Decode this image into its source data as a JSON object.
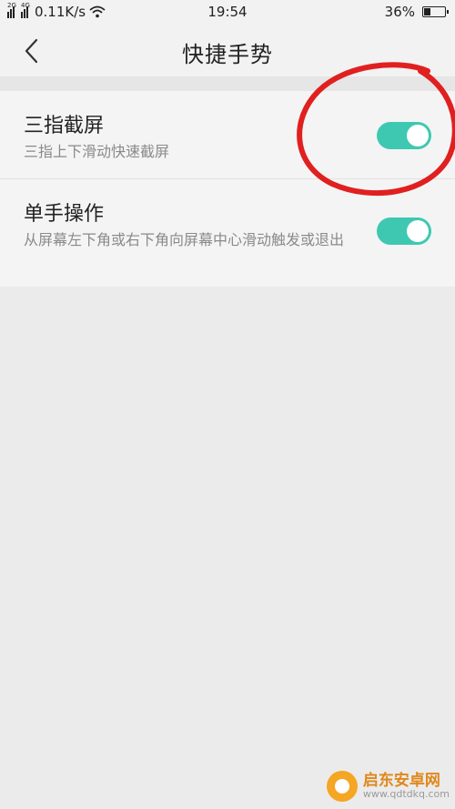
{
  "status_bar": {
    "net_tag_1": "2G",
    "net_tag_2": "4G",
    "speed": "0.11K/s",
    "time": "19:54",
    "battery_percent": "36%",
    "battery_level": 0.36
  },
  "header": {
    "back_icon": "chevron-left-icon",
    "title": "快捷手势"
  },
  "settings": [
    {
      "title": "三指截屏",
      "subtitle": "三指上下滑动快速截屏",
      "enabled": true
    },
    {
      "title": "单手操作",
      "subtitle": "从屏幕左下角或右下角向屏幕中心滑动触发或退出",
      "enabled": true
    }
  ],
  "colors": {
    "toggle_on": "#3ec8b2",
    "annotation": "#e02020"
  },
  "watermark": {
    "name": "启东安卓网",
    "url": "www.qdtdkq.com"
  }
}
